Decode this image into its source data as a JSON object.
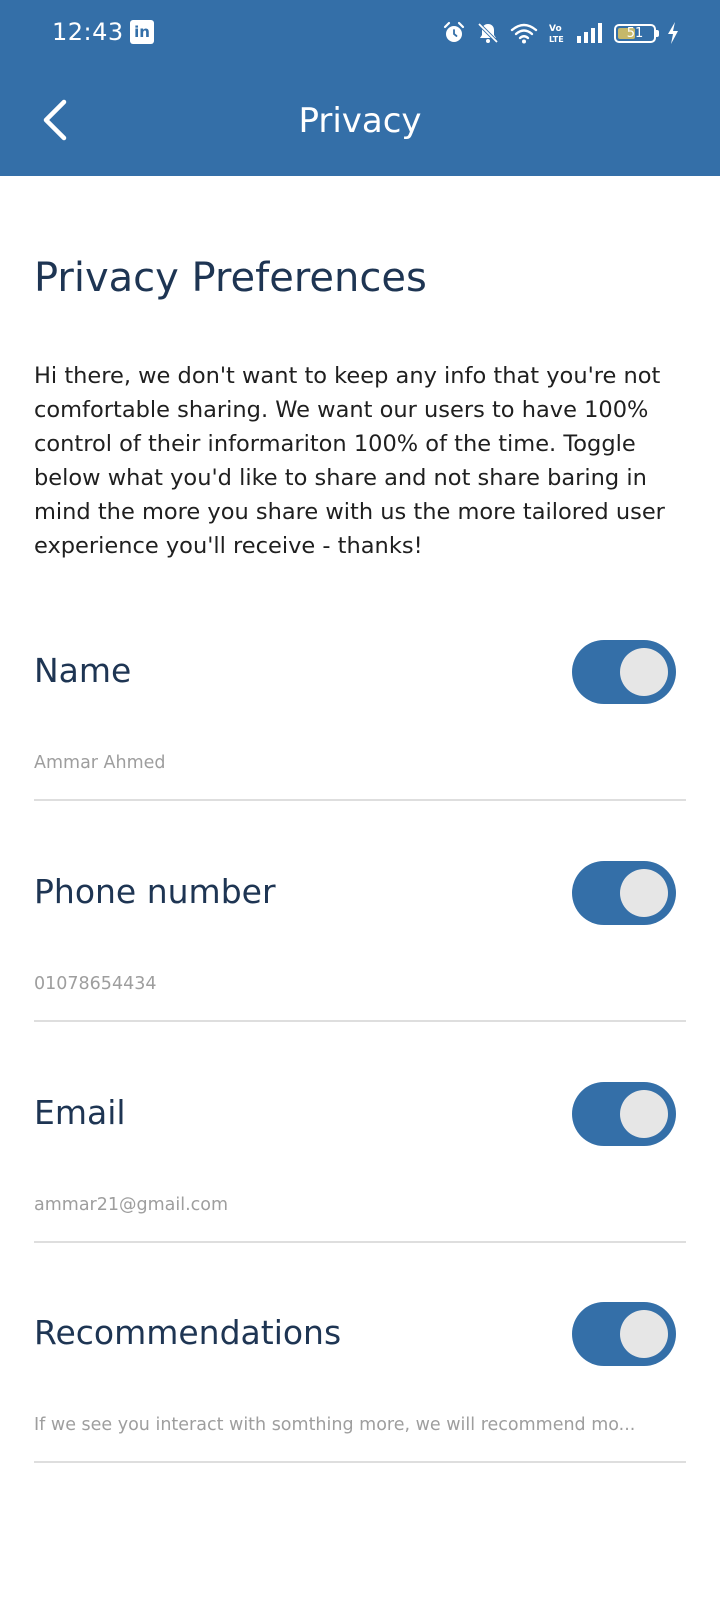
{
  "status_bar": {
    "time": "12:43",
    "app_icon": "linkedin-icon",
    "icons": [
      "alarm-icon",
      "bell-off-icon",
      "wifi-icon",
      "volte-icon",
      "signal-icon",
      "battery-icon",
      "charging-icon"
    ],
    "volte": "Vo LTE",
    "battery_level": "51",
    "battery_fraction": 0.51
  },
  "header": {
    "title": "Privacy",
    "back_icon": "back-arrow-icon",
    "background": "#346fa8"
  },
  "content": {
    "heading": "Privacy Preferences",
    "intro": "Hi there, we don't want to keep any info that you're not comfortable sharing. We want our users to have 100% control of their informariton 100% of the time. Toggle below what you'd like to share and not share baring in mind the more you share with us the more tailored user experience you'll receive - thanks!"
  },
  "preferences": [
    {
      "label": "Name",
      "value": "Ammar Ahmed",
      "enabled": true
    },
    {
      "label": "Phone number",
      "value": "01078654434",
      "enabled": true
    },
    {
      "label": "Email",
      "value": "ammar21@gmail.com",
      "enabled": true
    },
    {
      "label": "Recommendations",
      "value": "If we see you interact with somthing more, we will recommend mo...",
      "enabled": true
    }
  ],
  "colors": {
    "primary": "#346fa8",
    "heading_text": "#1e3553",
    "muted_text": "#9e9e9e",
    "toggle_knob": "#e6e6e6"
  }
}
